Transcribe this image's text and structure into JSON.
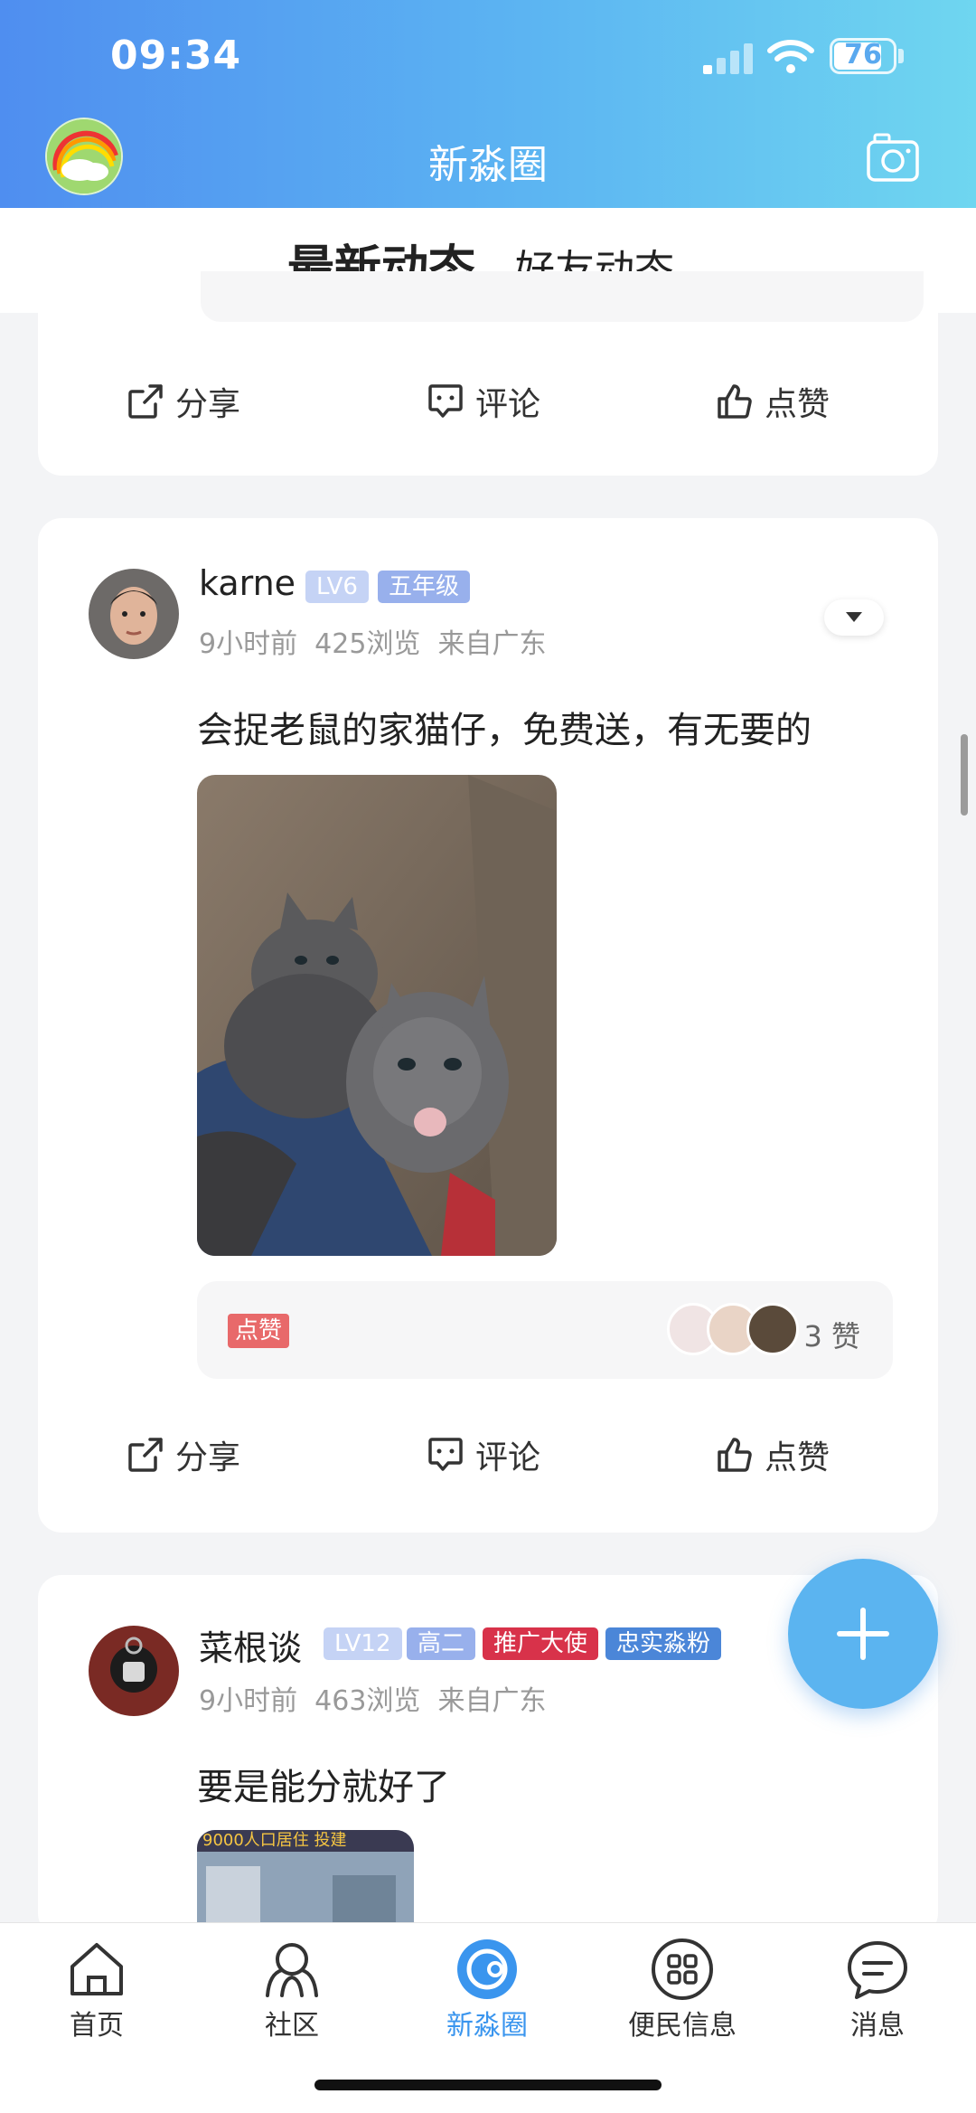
{
  "status_bar": {
    "time": "09:34",
    "battery": "76"
  },
  "header": {
    "title": "新淼圈"
  },
  "tabs": [
    {
      "label": "最新动态",
      "active": true
    },
    {
      "label": "好友动态",
      "active": false
    }
  ],
  "actions": {
    "share": "分享",
    "comment": "评论",
    "like": "点赞"
  },
  "posts": [
    {
      "author": "karne",
      "badges": [
        "LV6",
        "五年级"
      ],
      "time": "9小时前",
      "views": "425浏览",
      "location": "来自广东",
      "text": "会捉老鼠的家猫仔，免费送，有无要的",
      "like_tag": "点赞",
      "like_count": "3 赞"
    },
    {
      "author": "菜根谈",
      "badges": [
        "LV12",
        "高二",
        "推广大使",
        "忠实淼粉"
      ],
      "time": "9小时前",
      "views": "463浏览",
      "location": "来自广东",
      "text": "要是能分就好了",
      "image_caption": "9000人口居住 投建"
    }
  ],
  "bottom_nav": [
    {
      "label": "首页",
      "icon": "home-icon"
    },
    {
      "label": "社区",
      "icon": "community-icon"
    },
    {
      "label": "新淼圈",
      "icon": "circle-icon",
      "active": true
    },
    {
      "label": "便民信息",
      "icon": "grid-icon"
    },
    {
      "label": "消息",
      "icon": "message-icon"
    }
  ],
  "colors": {
    "accent": "#3a95ee",
    "header_start": "#4f8ef0",
    "header_end": "#6fd6f0",
    "like_tag": "#e8696a"
  }
}
